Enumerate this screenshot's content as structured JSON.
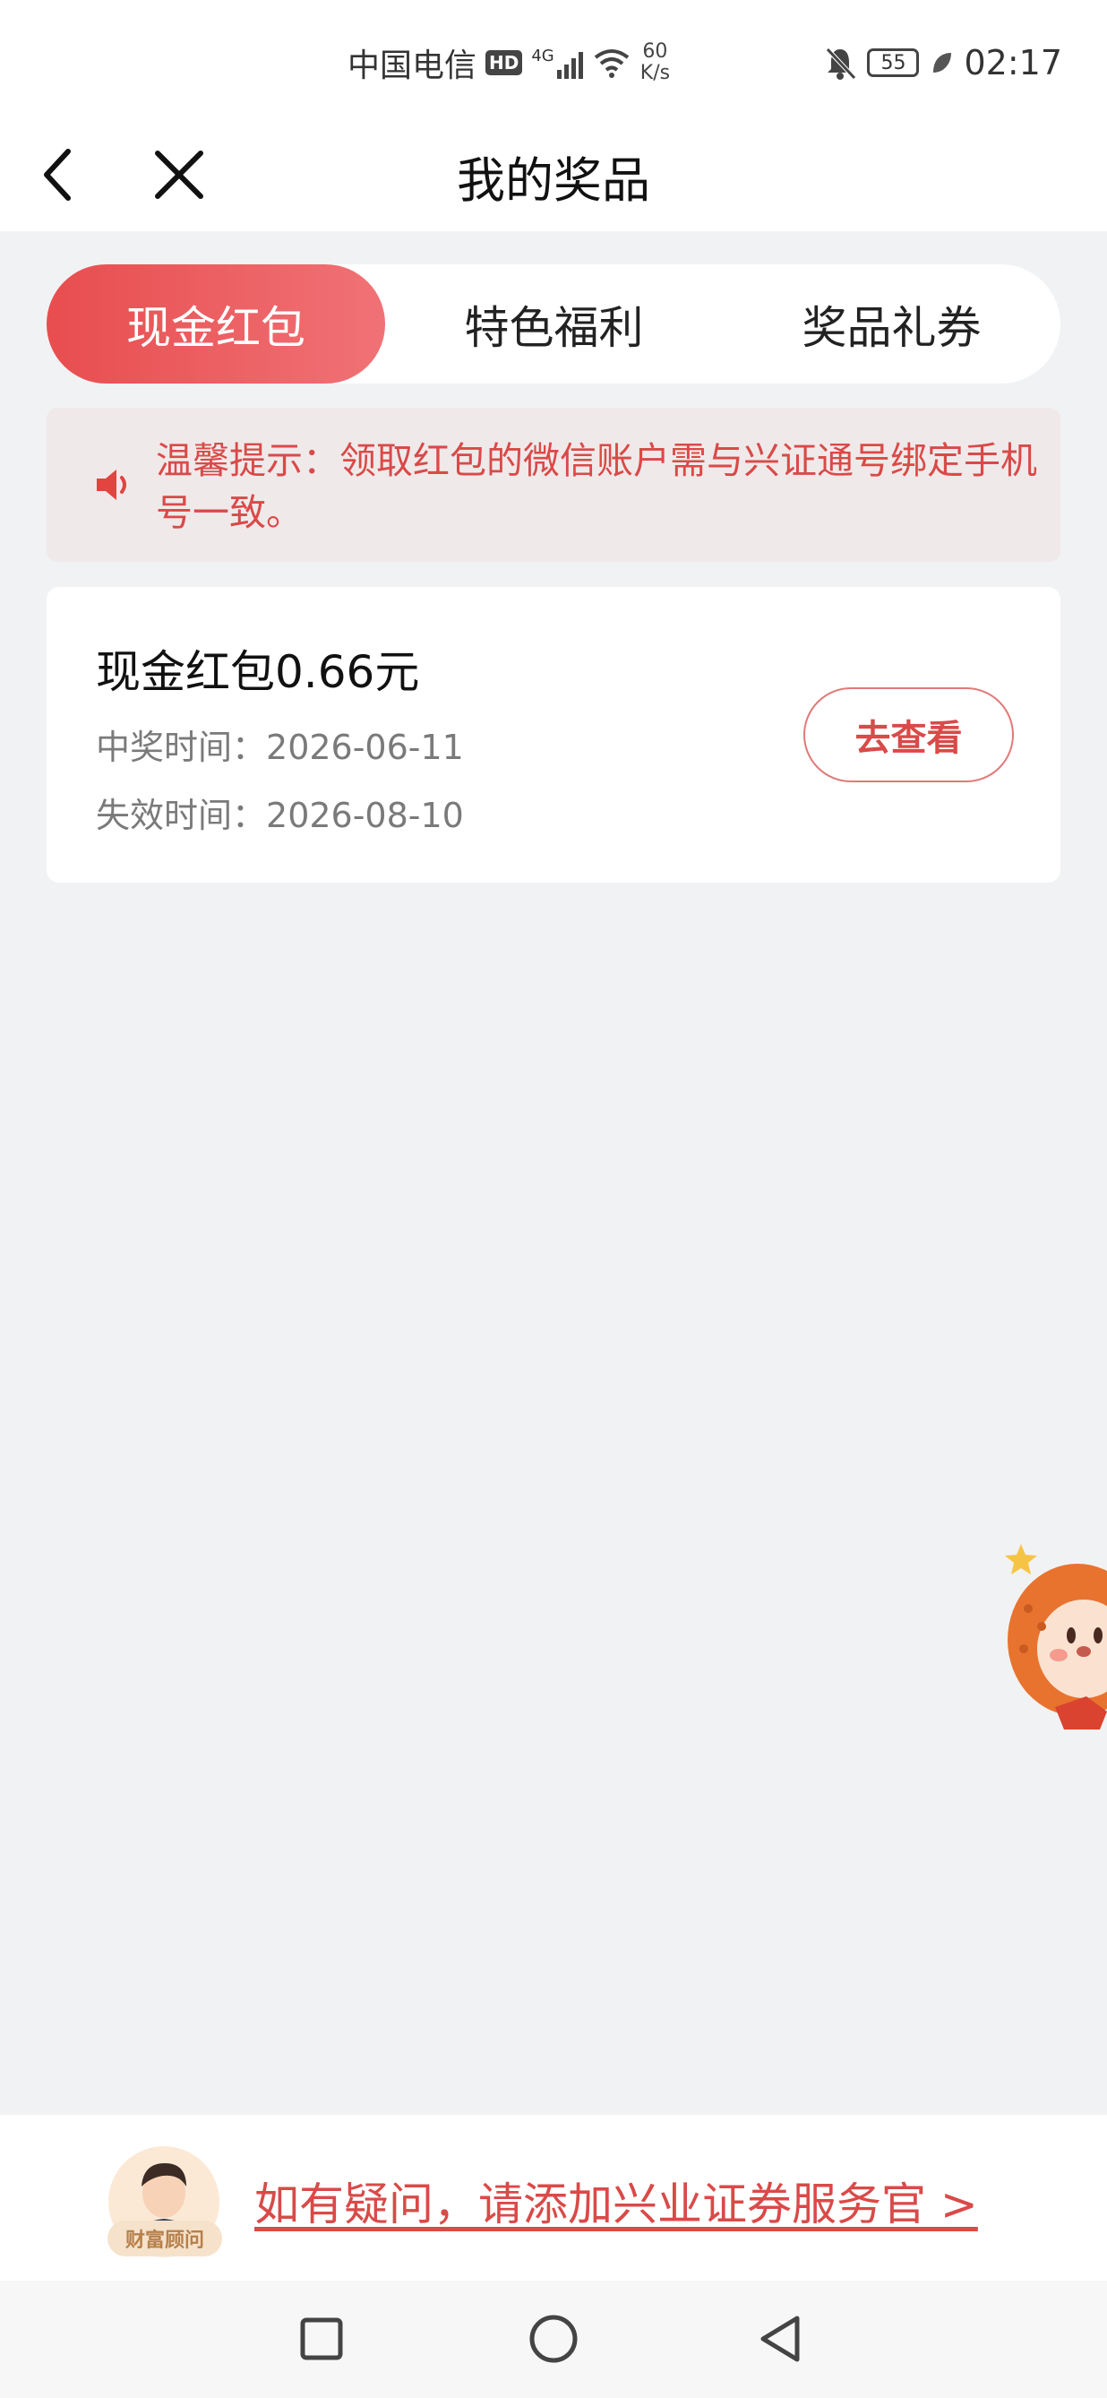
{
  "status_bar": {
    "carrier": "中国电信",
    "hd": "HD",
    "network": "4G",
    "speed_value": "60",
    "speed_unit": "K/s",
    "battery": "55",
    "time": "02:17"
  },
  "nav": {
    "title": "我的奖品"
  },
  "tabs": [
    {
      "label": "现金红包",
      "active": true
    },
    {
      "label": "特色福利",
      "active": false
    },
    {
      "label": "奖品礼券",
      "active": false
    }
  ],
  "notice": {
    "text": "温馨提示：领取红包的微信账户需与兴证通号绑定手机号一致。"
  },
  "prize": {
    "title": "现金红包0.66元",
    "win_label": "中奖时间：",
    "win_date": "2026-06-11",
    "expire_label": "失效时间：",
    "expire_date": "2026-08-10",
    "button_label": "去查看"
  },
  "service": {
    "avatar_label": "财富顾问",
    "link_text": "如有疑问，请添加兴业证券服务官 >"
  },
  "colors": {
    "accent": "#e84d4f",
    "notice_text": "#d94a48",
    "background": "#f1f2f4"
  }
}
